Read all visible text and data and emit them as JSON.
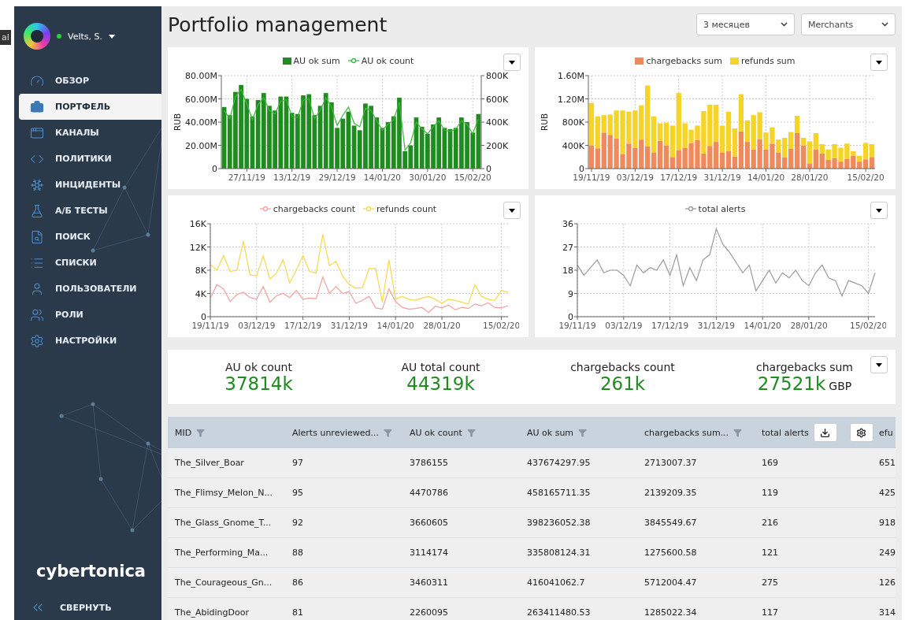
{
  "edge_tooltip": "al",
  "sidebar": {
    "user": {
      "name": "Velts, S.",
      "online": true
    },
    "items": [
      {
        "label": "ОБЗОР",
        "selected": false
      },
      {
        "label": "ПОРТФЕЛЬ",
        "selected": true
      },
      {
        "label": "КАНАЛЫ",
        "selected": false
      },
      {
        "label": "ПОЛИТИКИ",
        "selected": false
      },
      {
        "label": "ИНЦИДЕНТЫ",
        "selected": false
      },
      {
        "label": "А/Б ТЕСТЫ",
        "selected": false
      },
      {
        "label": "ПОИСК",
        "selected": false
      },
      {
        "label": "СПИСКИ",
        "selected": false
      },
      {
        "label": "ПОЛЬЗОВАТЕЛИ",
        "selected": false
      },
      {
        "label": "РОЛИ",
        "selected": false
      },
      {
        "label": "НАСТРОЙКИ",
        "selected": false
      }
    ],
    "logo": "cybertonica",
    "collapse": "СВЕРНУТЬ"
  },
  "header": {
    "title": "Portfolio management",
    "filters": [
      {
        "value": "3 месяцев"
      },
      {
        "value": "Merchants"
      }
    ]
  },
  "charts": [
    {
      "chart_data": {
        "type": "bar",
        "grid": true,
        "ylabel": "RUB",
        "ylim": [
          0,
          80000000
        ],
        "y2lim": [
          0,
          800000
        ],
        "categories": [
          null,
          null,
          null,
          null,
          "27/11/19",
          null,
          null,
          null,
          null,
          null,
          null,
          null,
          "13/12/19",
          null,
          null,
          null,
          null,
          null,
          null,
          null,
          "29/12/19",
          null,
          null,
          null,
          null,
          null,
          null,
          null,
          "14/01/20",
          null,
          null,
          null,
          null,
          null,
          null,
          null,
          "30/01/20",
          null,
          null,
          null,
          null,
          null,
          null,
          null,
          "15/02/20",
          null
        ],
        "yticks": [
          {
            "value": 0,
            "label": "0"
          },
          {
            "value": 20000000,
            "label": "20.00M"
          },
          {
            "value": 40000000,
            "label": "40.00M"
          },
          {
            "value": 60000000,
            "label": "60.00M"
          },
          {
            "value": 80000000,
            "label": "80.00M"
          }
        ],
        "y2ticks": [
          {
            "value": 0,
            "label": "0"
          },
          {
            "value": 200000,
            "label": "200K"
          },
          {
            "value": 400000,
            "label": "400K"
          },
          {
            "value": 600000,
            "label": "600K"
          },
          {
            "value": 800000,
            "label": "800K"
          }
        ],
        "series": [
          {
            "name": "AU ok sum",
            "color": "#1f8c1f",
            "type": "bar",
            "axis": "y",
            "values": [
              53000000.0,
              46000000.0,
              66000000.0,
              72000000.0,
              60000000.0,
              45000000.0,
              59000000.0,
              65000000.0,
              54000000.0,
              50000000.0,
              62000000.0,
              62000000.0,
              48000000.0,
              47000000.0,
              63000000.0,
              64000000.0,
              46000000.0,
              54000000.0,
              65000000.0,
              57000000.0,
              35000000.0,
              43000000.0,
              49000000.0,
              37000000.0,
              33000000.0,
              56000000.0,
              54000000.0,
              44000000.0,
              35000000.0,
              40000000.0,
              45000000.0,
              61000000.0,
              15000000.0,
              20000000.0,
              44000000.0,
              36000000.0,
              30000000.0,
              38000000.0,
              44000000.0,
              35000000.0,
              34000000.0,
              35000000.0,
              44000000.0,
              40000000.0,
              31000000.0,
              47000000.0
            ]
          },
          {
            "name": "AU ok count",
            "color": "#3cb83c",
            "type": "line",
            "axis": "y2",
            "values": [
              500000.0,
              430000.0,
              620000.0,
              680000.0,
              560000.0,
              420000.0,
              550000.0,
              610000.0,
              500000.0,
              470000.0,
              580000.0,
              590000.0,
              450000.0,
              440000.0,
              590000.0,
              600000.0,
              430000.0,
              500000.0,
              610000.0,
              530000.0,
              370000.0,
              460000.0,
              530000.0,
              390000.0,
              360000.0,
              520000.0,
              500000.0,
              410000.0,
              330000.0,
              380000.0,
              420000.0,
              570000.0,
              160000.0,
              220000.0,
              400000.0,
              340000.0,
              300000.0,
              360000.0,
              410000.0,
              330000.0,
              320000.0,
              340000.0,
              410000.0,
              380000.0,
              300000.0,
              430000.0
            ]
          }
        ]
      }
    },
    {
      "chart_data": {
        "type": "bar",
        "stacked": true,
        "grid": true,
        "ylabel": "RUB",
        "ylim": [
          0,
          1600000
        ],
        "categories": [
          "19/11/19",
          null,
          null,
          null,
          null,
          null,
          null,
          "03/12/19",
          null,
          null,
          null,
          null,
          null,
          null,
          "17/12/19",
          null,
          null,
          null,
          null,
          null,
          null,
          "31/12/19",
          null,
          null,
          null,
          null,
          null,
          null,
          "14/01/20",
          null,
          null,
          null,
          null,
          null,
          null,
          "28/01/20",
          null,
          null,
          null,
          null,
          null,
          null,
          null,
          null,
          "15/02/20",
          null
        ],
        "yticks": [
          {
            "value": 0,
            "label": "0"
          },
          {
            "value": 400000,
            "label": "400K"
          },
          {
            "value": 800000,
            "label": "800K"
          },
          {
            "value": 1200000,
            "label": "1.20M"
          },
          {
            "value": 1600000,
            "label": "1.60M"
          }
        ],
        "series": [
          {
            "name": "chargebacks sum",
            "color": "#f08a5d",
            "type": "bar",
            "axis": "y",
            "values": [
              400000.0,
              350000.0,
              620000.0,
              580000.0,
              520000.0,
              250000.0,
              430000.0,
              360000.0,
              500000.0,
              380000.0,
              280000.0,
              480000.0,
              400000.0,
              200000.0,
              320000.0,
              360000.0,
              440000.0,
              490000.0,
              260000.0,
              390000.0,
              460000.0,
              280000.0,
              300000.0,
              210000.0,
              640000.0,
              460000.0,
              330000.0,
              510000.0,
              330000.0,
              430000.0,
              280000.0,
              190000.0,
              340000.0,
              610000.0,
              400000.0,
              90000.0,
              330000.0,
              260000.0,
              150000.0,
              180000.0,
              120000.0,
              170000.0,
              220000.0,
              120000.0,
              160000.0,
              200000.0
            ]
          },
          {
            "name": "refunds sum",
            "color": "#f5d327",
            "type": "bar",
            "axis": "y",
            "values": [
              730000.0,
              550000.0,
              300000.0,
              350000.0,
              480000.0,
              750000.0,
              550000.0,
              640000.0,
              590000.0,
              1050000.0,
              620000.0,
              300000.0,
              390000.0,
              540000.0,
              980000.0,
              420000.0,
              230000.0,
              250000.0,
              730000.0,
              710000.0,
              640000.0,
              460000.0,
              680000.0,
              480000.0,
              640000.0,
              370000.0,
              590000.0,
              460000.0,
              290000.0,
              280000.0,
              220000.0,
              340000.0,
              290000.0,
              300000.0,
              130000.0,
              380000.0,
              280000.0,
              160000.0,
              180000.0,
              240000.0,
              240000.0,
              260000.0,
              80000.0,
              100000.0,
              280000.0,
              220000.0
            ]
          }
        ]
      }
    },
    {
      "chart_data": {
        "type": "line",
        "grid": true,
        "ylim": [
          0,
          16000
        ],
        "categories": [
          "19/11/19",
          null,
          null,
          null,
          null,
          null,
          null,
          "03/12/19",
          null,
          null,
          null,
          null,
          null,
          null,
          "17/12/19",
          null,
          null,
          null,
          null,
          null,
          null,
          "31/12/19",
          null,
          null,
          null,
          null,
          null,
          null,
          "14/01/20",
          null,
          null,
          null,
          null,
          null,
          null,
          "28/01/20",
          null,
          null,
          null,
          null,
          null,
          null,
          null,
          null,
          "15/02/20",
          null
        ],
        "yticks": [
          {
            "value": 0,
            "label": "0"
          },
          {
            "value": 4000,
            "label": "4K"
          },
          {
            "value": 8000,
            "label": "8K"
          },
          {
            "value": 12000,
            "label": "12K"
          },
          {
            "value": 16000,
            "label": "16K"
          }
        ],
        "series": [
          {
            "name": "chargebacks count",
            "color": "#f2a0a0",
            "type": "line",
            "axis": "y",
            "values": [
              3200,
              5500,
              4800,
              2600,
              3800,
              4200,
              3300,
              3000,
              5200,
              2500,
              3600,
              4000,
              3300,
              4500,
              3000,
              3200,
              3100,
              6800,
              4000,
              5200,
              4000,
              4300,
              2300,
              2800,
              3500,
              1500,
              1300,
              4800,
              2600,
              1600,
              1300,
              1400,
              1600,
              700,
              1800,
              1500,
              2000,
              1200,
              1600,
              1400,
              2200,
              1900,
              2400,
              1600,
              1500,
              1900
            ]
          },
          {
            "name": "refunds count",
            "color": "#f7d84a",
            "type": "line",
            "axis": "y",
            "values": [
              9000,
              8000,
              10500,
              7800,
              8000,
              13000,
              7200,
              7000,
              10500,
              6500,
              7500,
              9800,
              5800,
              8000,
              10500,
              7800,
              7500,
              14200,
              8800,
              9500,
              7000,
              5500,
              4900,
              5000,
              8300,
              8300,
              2500,
              9800,
              3000,
              3500,
              3000,
              2800,
              3200,
              3500,
              3000,
              2300,
              3000,
              2800,
              2500,
              2200,
              5500,
              3500,
              3000,
              2800,
              4500,
              4200
            ]
          }
        ]
      }
    },
    {
      "chart_data": {
        "type": "line",
        "grid": true,
        "ylim": [
          0,
          36
        ],
        "categories": [
          "19/11/19",
          null,
          null,
          null,
          null,
          null,
          null,
          "03/12/19",
          null,
          null,
          null,
          null,
          null,
          null,
          "17/12/19",
          null,
          null,
          null,
          null,
          null,
          null,
          "31/12/19",
          null,
          null,
          null,
          null,
          null,
          null,
          "14/01/20",
          null,
          null,
          null,
          null,
          null,
          null,
          "28/01/20",
          null,
          null,
          null,
          null,
          null,
          null,
          null,
          null,
          "15/02/20",
          null
        ],
        "yticks": [
          0,
          9,
          18,
          27,
          36
        ],
        "series": [
          {
            "name": "total alerts",
            "color": "#9a9a9a",
            "type": "line",
            "axis": "y",
            "values": [
              20,
              16,
              19,
              22,
              17,
              18,
              18,
              16,
              12,
              20,
              17,
              19,
              18,
              22,
              16,
              24,
              12,
              19,
              14,
              22,
              24,
              34,
              28,
              25,
              21,
              17,
              20,
              10,
              14,
              18,
              13,
              17,
              15,
              18,
              14,
              12,
              17,
              20,
              15,
              14,
              8,
              14,
              13,
              12,
              9,
              17
            ]
          }
        ]
      }
    }
  ],
  "kpis": {
    "items": [
      {
        "label": "AU ok count",
        "value": "37814k"
      },
      {
        "label": "AU total count",
        "value": "44319k"
      },
      {
        "label": "chargebacks count",
        "value": "261k"
      },
      {
        "label": "chargebacks sum",
        "value": "27521k",
        "unit": "GBP"
      }
    ]
  },
  "table": {
    "columns": [
      {
        "label": "MID",
        "filter": true
      },
      {
        "label": "Alerts unreviewed...",
        "filter": true
      },
      {
        "label": "AU ok count",
        "filter": true
      },
      {
        "label": "AU ok sum",
        "filter": true
      },
      {
        "label": "chargebacks sum...",
        "filter": true
      },
      {
        "label": "total alerts",
        "filter": false
      },
      {
        "label": "efu",
        "filter": false
      }
    ],
    "rows": [
      [
        "The_Silver_Boar",
        "97",
        "3786155",
        "437674297.95",
        "2713007.37",
        "169",
        "651"
      ],
      [
        "The_Flimsy_Melon_N...",
        "95",
        "4470786",
        "458165711.35",
        "2139209.35",
        "119",
        "425"
      ],
      [
        "The_Glass_Gnome_T...",
        "92",
        "3660605",
        "398236052.38",
        "3845549.67",
        "216",
        "918"
      ],
      [
        "The_Performing_Ma...",
        "88",
        "3114174",
        "335808124.31",
        "1275600.58",
        "121",
        "249"
      ],
      [
        "The_Courageous_Gn...",
        "86",
        "3460311",
        "416041062.7",
        "5712004.47",
        "275",
        "126"
      ],
      [
        "The_AbidingDoor",
        "81",
        "2260095",
        "263411480.53",
        "1285022.34",
        "117",
        "314"
      ]
    ]
  }
}
